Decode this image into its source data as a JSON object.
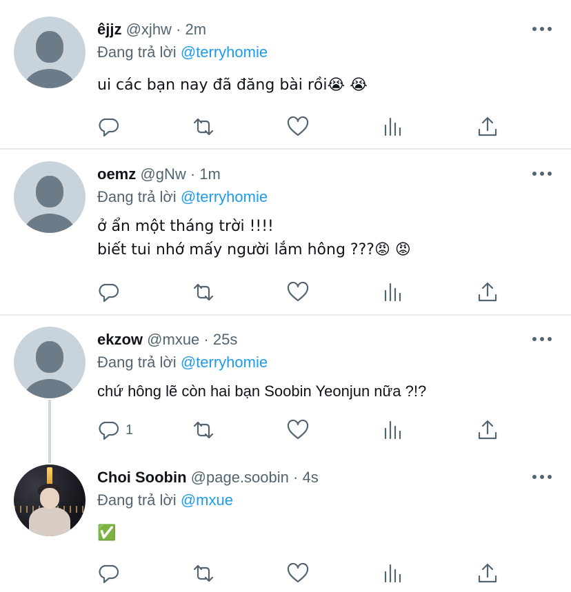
{
  "tweets": [
    {
      "name": "êjjz",
      "handle": "@xjhw",
      "time": "2m",
      "replying_prefix": "Đang trả lời",
      "replying_to": "@terryhomie",
      "text": "ui các bạn nay đã đăng bài rồi😭 😭",
      "reply_count": ""
    },
    {
      "name": "oemz",
      "handle": "@gNw",
      "time": "1m",
      "replying_prefix": "Đang trả lời",
      "replying_to": "@terryhomie",
      "text": "ở ẩn một tháng trời !!!!\nbiết tui nhớ mấy người lắm hông ???😡 😡",
      "reply_count": ""
    },
    {
      "name": "ekzow",
      "handle": "@mxue",
      "time": "25s",
      "replying_prefix": "Đang trả lời",
      "replying_to": "@terryhomie",
      "text": "chứ hông lẽ còn hai bạn Soobin Yeonjun nữa ?!?",
      "reply_count": "1"
    },
    {
      "name": "Choi Soobin",
      "handle": "@page.soobin",
      "time": "4s",
      "replying_prefix": "Đang trả lời",
      "replying_to": "@mxue",
      "text": "✅",
      "reply_count": ""
    }
  ],
  "separator": "·",
  "icons": {
    "reply": "reply-icon",
    "retweet": "retweet-icon",
    "like": "heart-icon",
    "views": "analytics-icon",
    "share": "share-icon",
    "more": "more-icon",
    "default_avatar": "default-avatar",
    "photo_avatar": "profile-photo"
  },
  "colors": {
    "accent": "#1d9bf0",
    "muted": "#536471",
    "text": "#0f1419",
    "divider": "#e8ebed"
  }
}
